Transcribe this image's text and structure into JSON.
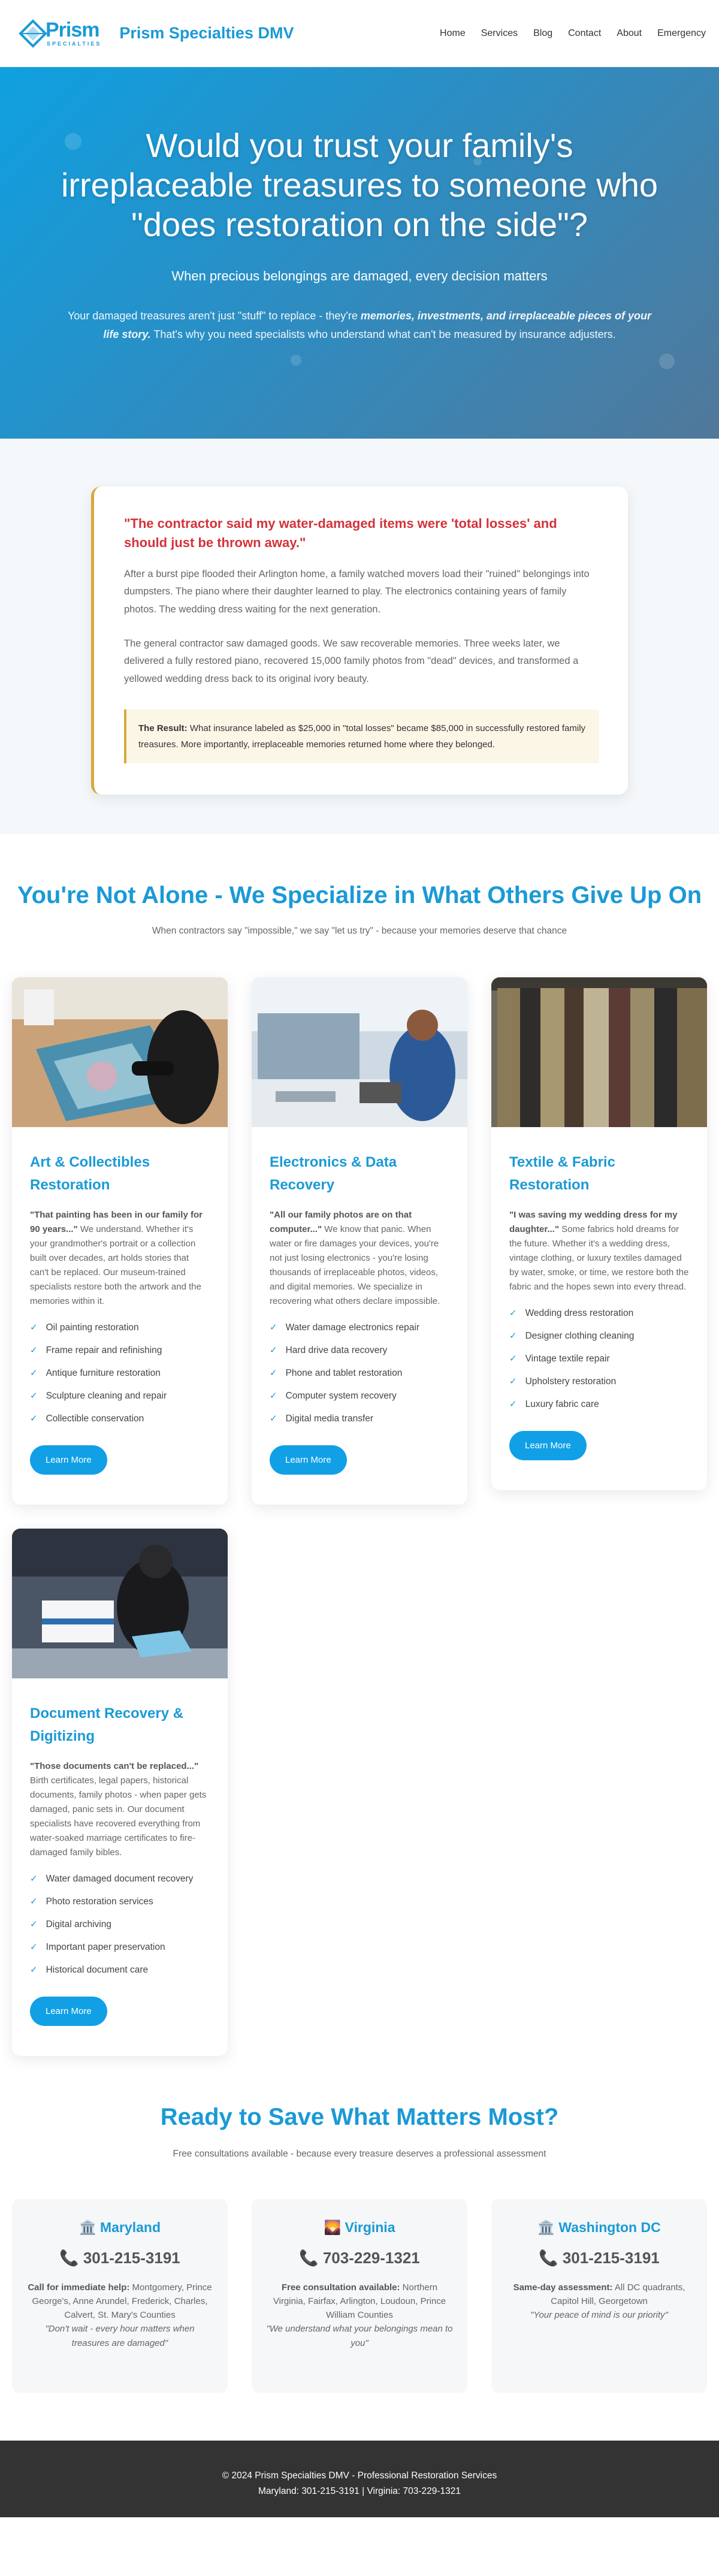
{
  "header": {
    "logo_word": "Prism",
    "logo_sub": "SPECIALTIES",
    "site_name": "Prism Specialties DMV",
    "nav": [
      "Home",
      "Services",
      "Blog",
      "Contact",
      "About",
      "Emergency"
    ]
  },
  "hero": {
    "title": "Would you trust your family's irreplaceable treasures to someone who \"does restoration on the side\"?",
    "subtitle": "When precious belongings are damaged, every decision matters",
    "para_before": "Your damaged treasures aren't just \"stuff\" to replace - they're ",
    "para_em": "memories, investments, and irreplaceable pieces of your life story.",
    "para_after": " That's why you need specialists who understand what can't be measured by insurance adjusters."
  },
  "story": {
    "quote": "\"The contractor said my water-damaged items were 'total losses' and should just be thrown away.\"",
    "p1": "After a burst pipe flooded their Arlington home, a family watched movers load their \"ruined\" belongings into dumpsters. The piano where their daughter learned to play. The electronics containing years of family photos. The wedding dress waiting for the next generation.",
    "p2": "The general contractor saw damaged goods. We saw recoverable memories. Three weeks later, we delivered a fully restored piano, recovered 15,000 family photos from \"dead\" devices, and transformed a yellowed wedding dress back to its original ivory beauty.",
    "result_label": "The Result:",
    "result_text": " What insurance labeled as $25,000 in \"total losses\" became $85,000 in successfully restored family treasures. More importantly, irreplaceable memories returned home where they belonged."
  },
  "services": {
    "title": "You're Not Alone - We Specialize in What Others Give Up On",
    "subtitle": "When contractors say \"impossible,\" we say \"let us try\" - because your memories deserve that chance",
    "learn_more": "Learn More",
    "cards": [
      {
        "title": "Art & Collectibles Restoration",
        "lead": "\"That painting has been in our family for 90 years...\"",
        "desc": " We understand. Whether it's your grandmother's portrait or a collection built over decades, art holds stories that can't be replaced. Our museum-trained specialists restore both the artwork and the memories within it.",
        "features": [
          "Oil painting restoration",
          "Frame repair and refinishing",
          "Antique furniture restoration",
          "Sculpture cleaning and repair",
          "Collectible conservation"
        ]
      },
      {
        "title": "Electronics & Data Recovery",
        "lead": "\"All our family photos are on that computer...\"",
        "desc": " We know that panic. When water or fire damages your devices, you're not just losing electronics - you're losing thousands of irreplaceable photos, videos, and digital memories. We specialize in recovering what others declare impossible.",
        "features": [
          "Water damage electronics repair",
          "Hard drive data recovery",
          "Phone and tablet restoration",
          "Computer system recovery",
          "Digital media transfer"
        ]
      },
      {
        "title": "Textile & Fabric Restoration",
        "lead": "\"I was saving my wedding dress for my daughter...\"",
        "desc": " Some fabrics hold dreams for the future. Whether it's a wedding dress, vintage clothing, or luxury textiles damaged by water, smoke, or time, we restore both the fabric and the hopes sewn into every thread.",
        "features": [
          "Wedding dress restoration",
          "Designer clothing cleaning",
          "Vintage textile repair",
          "Upholstery restoration",
          "Luxury fabric care"
        ]
      },
      {
        "title": "Document Recovery & Digitizing",
        "lead": "\"Those documents can't be replaced...\"",
        "desc": " Birth certificates, legal papers, historical documents, family photos - when paper gets damaged, panic sets in. Our document specialists have recovered everything from water-soaked marriage certificates to fire-damaged family bibles.",
        "features": [
          "Water damaged document recovery",
          "Photo restoration services",
          "Digital archiving",
          "Important paper preservation",
          "Historical document care"
        ]
      }
    ]
  },
  "contact": {
    "title": "Ready to Save What Matters Most?",
    "subtitle": "Free consultations available - because every treasure deserves a professional assessment",
    "locations": [
      {
        "icon": "🏛️",
        "name": "Maryland",
        "phone": "301-215-3191",
        "lead": "Call for immediate help:",
        "areas": " Montgomery, Prince George's, Anne Arundel, Frederick, Charles, Calvert, St. Mary's Counties",
        "tagline": "\"Don't wait - every hour matters when treasures are damaged\""
      },
      {
        "icon": "🌄",
        "name": "Virginia",
        "phone": "703-229-1321",
        "lead": "Free consultation available:",
        "areas": " Northern Virginia, Fairfax, Arlington, Loudoun, Prince William Counties",
        "tagline": "\"We understand what your belongings mean to you\""
      },
      {
        "icon": "🏛️",
        "name": "Washington DC",
        "phone": "301-215-3191",
        "lead": "Same-day assessment:",
        "areas": " All DC quadrants, Capitol Hill, Georgetown",
        "tagline": "\"Your peace of mind is our priority\""
      }
    ]
  },
  "footer": {
    "line1": "© 2024 Prism Specialties DMV - Professional Restoration Services",
    "line2": "Maryland: 301-215-3191 | Virginia: 703-229-1321"
  },
  "colors": {
    "accent": "#1a9ad6",
    "alert": "#d3333a",
    "gold": "#d7a93c",
    "footer": "#333333"
  }
}
